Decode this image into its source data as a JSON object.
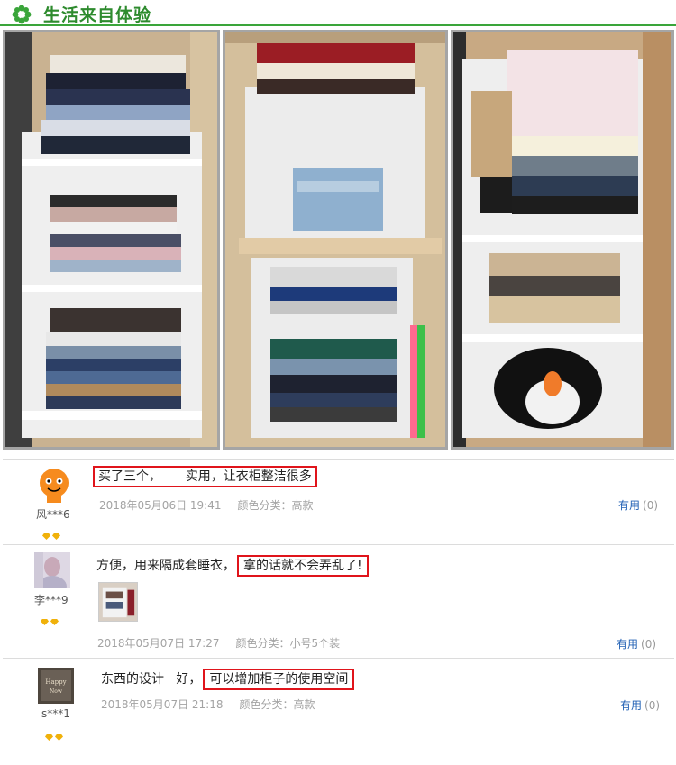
{
  "header": {
    "title": "生活来自体验",
    "icon": "flower-icon",
    "accent": "#3aa53a"
  },
  "photos": [
    {
      "name": "wardrobe-photo-1"
    },
    {
      "name": "wardrobe-photo-2"
    },
    {
      "name": "wardrobe-photo-3"
    }
  ],
  "reviews": [
    {
      "username": "风***6",
      "text_plain": "买了三个，      ",
      "text_highlight": "实用，让衣柜整洁很多",
      "date": "2018年05月06日 19:41",
      "variant_label": "颜色分类：",
      "variant": "高款",
      "useful_label": "有用",
      "useful_count": "(0)"
    },
    {
      "username": "李***9",
      "text_plain": "方便，用来隔成套睡衣，",
      "text_highlight": "拿的话就不会弄乱了!",
      "date": "2018年05月07日 17:27",
      "variant_label": "颜色分类：",
      "variant": "小号5个装",
      "useful_label": "有用",
      "useful_count": "(0)"
    },
    {
      "username": "s***1",
      "text_plain": "东西的设计   好，",
      "text_highlight": "可以增加柜子的使用空间",
      "date": "2018年05月07日 21:18",
      "variant_label": "颜色分类：",
      "variant": "高款",
      "useful_label": "有用",
      "useful_count": "(0)"
    }
  ],
  "colors": {
    "highlight_border": "#e0141b",
    "link": "#1f5fb4",
    "meta": "#a3a3a3",
    "diamond": "#f0b10a"
  }
}
